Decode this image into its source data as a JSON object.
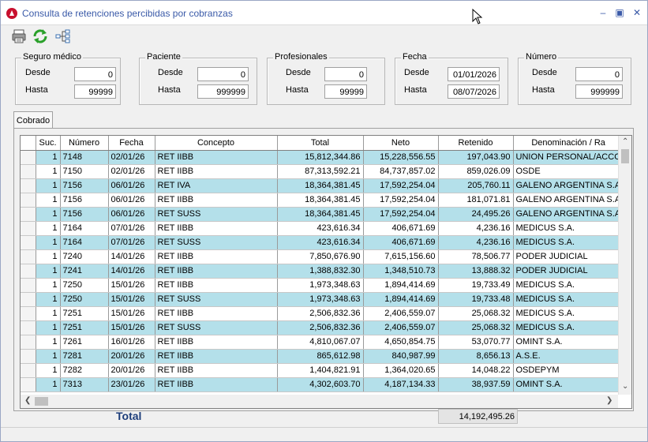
{
  "window": {
    "title": "Consulta de retenciones percibidas por cobranzas"
  },
  "toolbar": {
    "print_icon": "printer-icon",
    "refresh_icon": "refresh-icon",
    "tree_icon": "tree-icon"
  },
  "filters": {
    "seguro": {
      "title": "Seguro médico",
      "desde_label": "Desde",
      "desde": "0",
      "hasta_label": "Hasta",
      "hasta": "99999"
    },
    "paciente": {
      "title": "Paciente",
      "desde_label": "Desde",
      "desde": "0",
      "hasta_label": "Hasta",
      "hasta": "999999"
    },
    "profesionales": {
      "title": "Profesionales",
      "desde_label": "Desde",
      "desde": "0",
      "hasta_label": "Hasta",
      "hasta": "99999"
    },
    "fecha": {
      "title": "Fecha",
      "desde_label": "Desde",
      "desde": "01/01/2026",
      "hasta_label": "Hasta",
      "hasta": "08/07/2026"
    },
    "numero": {
      "title": "Número",
      "desde_label": "Desde",
      "desde": "0",
      "hasta_label": "Hasta",
      "hasta": "999999"
    }
  },
  "tabs": {
    "cobrado": "Cobrado"
  },
  "table": {
    "headers": [
      "Suc.",
      "Número",
      "Fecha",
      "Concepto",
      "Total",
      "Neto",
      "Retenido",
      "Denominación / Ra"
    ],
    "rows": [
      [
        "1",
        "7148",
        "02/01/26",
        "RET IIBB",
        "15,812,344.86",
        "15,228,556.55",
        "197,043.90",
        "UNION PERSONAL/ACCO"
      ],
      [
        "1",
        "7150",
        "02/01/26",
        "RET IIBB",
        "87,313,592.21",
        "84,737,857.02",
        "859,026.09",
        "OSDE"
      ],
      [
        "1",
        "7156",
        "06/01/26",
        "RET IVA",
        "18,364,381.45",
        "17,592,254.04",
        "205,760.11",
        "GALENO ARGENTINA S.A"
      ],
      [
        "1",
        "7156",
        "06/01/26",
        "RET IIBB",
        "18,364,381.45",
        "17,592,254.04",
        "181,071.81",
        "GALENO ARGENTINA S.A"
      ],
      [
        "1",
        "7156",
        "06/01/26",
        "RET SUSS",
        "18,364,381.45",
        "17,592,254.04",
        "24,495.26",
        "GALENO ARGENTINA S.A"
      ],
      [
        "1",
        "7164",
        "07/01/26",
        "RET IIBB",
        "423,616.34",
        "406,671.69",
        "4,236.16",
        "MEDICUS S.A."
      ],
      [
        "1",
        "7164",
        "07/01/26",
        "RET SUSS",
        "423,616.34",
        "406,671.69",
        "4,236.16",
        "MEDICUS S.A."
      ],
      [
        "1",
        "7240",
        "14/01/26",
        "RET IIBB",
        "7,850,676.90",
        "7,615,156.60",
        "78,506.77",
        "PODER JUDICIAL"
      ],
      [
        "1",
        "7241",
        "14/01/26",
        "RET IIBB",
        "1,388,832.30",
        "1,348,510.73",
        "13,888.32",
        "PODER JUDICIAL"
      ],
      [
        "1",
        "7250",
        "15/01/26",
        "RET IIBB",
        "1,973,348.63",
        "1,894,414.69",
        "19,733.49",
        "MEDICUS S.A."
      ],
      [
        "1",
        "7250",
        "15/01/26",
        "RET SUSS",
        "1,973,348.63",
        "1,894,414.69",
        "19,733.48",
        "MEDICUS S.A."
      ],
      [
        "1",
        "7251",
        "15/01/26",
        "RET IIBB",
        "2,506,832.36",
        "2,406,559.07",
        "25,068.32",
        "MEDICUS S.A."
      ],
      [
        "1",
        "7251",
        "15/01/26",
        "RET SUSS",
        "2,506,832.36",
        "2,406,559.07",
        "25,068.32",
        "MEDICUS S.A."
      ],
      [
        "1",
        "7261",
        "16/01/26",
        "RET IIBB",
        "4,810,067.07",
        "4,650,854.75",
        "53,070.77",
        "OMINT S.A."
      ],
      [
        "1",
        "7281",
        "20/01/26",
        "RET IIBB",
        "865,612.98",
        "840,987.99",
        "8,656.13",
        "A.S.E."
      ],
      [
        "1",
        "7282",
        "20/01/26",
        "RET IIBB",
        "1,404,821.91",
        "1,364,020.65",
        "14,048.22",
        "OSDEPYM"
      ],
      [
        "1",
        "7313",
        "23/01/26",
        "RET IIBB",
        "4,302,603.70",
        "4,187,134.33",
        "38,937.59",
        "OMINT S.A."
      ]
    ]
  },
  "footer": {
    "total_label": "Total",
    "total_value": "14,192,495.26"
  },
  "colors": {
    "title_text": "#3a5aa8",
    "row_alt": "#b4e0ea",
    "total_label": "#1c3d7a"
  }
}
